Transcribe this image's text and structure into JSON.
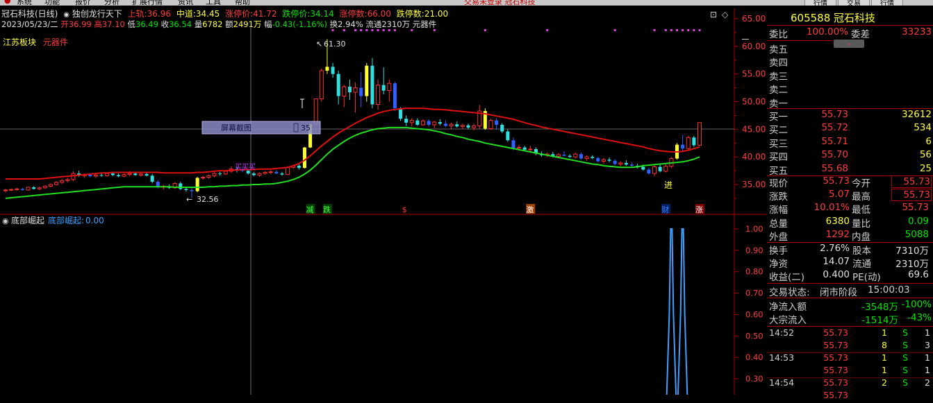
{
  "menu": {
    "items": [
      "系统",
      "功能",
      "报价",
      "分析",
      "扩展行情",
      "资讯",
      "工具",
      "帮助"
    ],
    "center_title": "交易未登录 冠石科技",
    "right_buttons": [
      "行情",
      "交易",
      "行情"
    ]
  },
  "header": {
    "stock": "冠石科技(日线)",
    "formula": "独创龙行天下",
    "up_label": "上轨:",
    "up": "36.96",
    "mid_label": "中道:",
    "mid": "34.45",
    "limit_up_label": "涨停价:",
    "limit_up": "41.72",
    "limit_down_label": "跌停价:",
    "limit_down": "34.14",
    "up_count_label": "涨停数:",
    "up_count": "66.00",
    "down_count_label": "跌停数:",
    "down_count": "21.00"
  },
  "info2": {
    "date": "2023/05/23/二",
    "open_label": "开",
    "open": "36.99",
    "high_label": "高",
    "high": "37.10",
    "low_label": "低",
    "low": "36.49",
    "close_label": "收",
    "close": "36.54",
    "vol_label": "量",
    "vol": "6782",
    "amt_label": "额",
    "amt": "2491万",
    "chg_label": "幅",
    "chg": "-0.43(-1.16%)",
    "turn": "换2.94%",
    "float": "流通2310万",
    "sector": "元器件"
  },
  "tags": {
    "board": "江苏板块",
    "sector": "元器件"
  },
  "chart_labels": {
    "high_mark": "61.30",
    "low_mark": "32.56",
    "screenshot": "屏幕截图",
    "cross_val": "35",
    "buy_text": "买买买",
    "jin": "进"
  },
  "signals": [
    "减",
    "跌",
    "$",
    "激",
    "财",
    "涨"
  ],
  "price_axis": [
    "65.00",
    "60.00",
    "55.00",
    "50.00",
    "45.00",
    "40.00",
    "35.00"
  ],
  "indicator": {
    "name": "底部崛起",
    "series_label": "底部崛起:",
    "value": "0.00",
    "axis": [
      "1.00",
      "0.90",
      "0.80",
      "0.70",
      "0.60",
      "0.50",
      "0.40",
      "0.30"
    ]
  },
  "chart_data": {
    "type": "candlestick",
    "ylim": [
      30,
      66
    ],
    "candles": [
      [
        33.9,
        34.2,
        33.6,
        34.0
      ],
      [
        34.0,
        34.3,
        33.8,
        34.1
      ],
      [
        34.1,
        34.4,
        33.9,
        34.2
      ],
      [
        34.2,
        34.4,
        33.9,
        34.0
      ],
      [
        34.0,
        34.6,
        33.9,
        34.5
      ],
      [
        34.5,
        34.7,
        34.1,
        34.2
      ],
      [
        34.2,
        34.6,
        34.0,
        34.4
      ],
      [
        34.4,
        34.9,
        34.2,
        34.7
      ],
      [
        34.7,
        35.2,
        34.5,
        35.0
      ],
      [
        35.0,
        35.6,
        34.8,
        35.4
      ],
      [
        35.4,
        36.0,
        35.1,
        35.7
      ],
      [
        35.7,
        36.2,
        35.4,
        35.9
      ],
      [
        35.9,
        37.4,
        35.6,
        37.0
      ],
      [
        37.0,
        37.5,
        36.4,
        36.6
      ],
      [
        36.6,
        37.0,
        36.2,
        36.8
      ],
      [
        36.8,
        37.0,
        36.3,
        36.5
      ],
      [
        36.5,
        36.9,
        36.2,
        36.7
      ],
      [
        36.7,
        37.1,
        36.4,
        36.6
      ],
      [
        36.6,
        37.2,
        36.4,
        37.0
      ],
      [
        37.0,
        37.2,
        36.5,
        36.7
      ],
      [
        36.7,
        37.0,
        36.3,
        36.5
      ],
      [
        36.5,
        37.0,
        36.3,
        36.8
      ],
      [
        36.8,
        37.4,
        36.5,
        37.0
      ],
      [
        37.0,
        37.3,
        36.6,
        36.7
      ],
      [
        36.7,
        37.1,
        36.4,
        36.9
      ],
      [
        36.9,
        37.2,
        36.5,
        36.6
      ],
      [
        36.6,
        36.9,
        35.2,
        35.5
      ],
      [
        35.5,
        35.8,
        34.3,
        34.5
      ],
      [
        34.5,
        34.9,
        34.1,
        34.7
      ],
      [
        34.7,
        35.0,
        34.2,
        34.4
      ],
      [
        34.4,
        35.4,
        34.2,
        35.2
      ],
      [
        35.2,
        35.5,
        34.0,
        34.2
      ],
      [
        34.2,
        34.6,
        33.7,
        34.0
      ],
      [
        34.0,
        34.4,
        32.6,
        33.8
      ],
      [
        33.8,
        36.4,
        33.6,
        36.2
      ],
      [
        36.2,
        36.6,
        35.9,
        36.3
      ],
      [
        36.3,
        36.8,
        36.0,
        36.6
      ],
      [
        36.6,
        37.2,
        36.3,
        37.0
      ],
      [
        37.0,
        37.3,
        36.6,
        36.9
      ],
      [
        36.9,
        37.6,
        36.7,
        37.4
      ],
      [
        37.4,
        38.3,
        37.1,
        37.8
      ],
      [
        37.8,
        38.2,
        37.2,
        37.6
      ],
      [
        37.6,
        38.0,
        37.2,
        37.5
      ],
      [
        37.5,
        37.8,
        36.8,
        37.0
      ],
      [
        37.0,
        37.3,
        36.5,
        36.7
      ],
      [
        36.7,
        37.2,
        36.4,
        37.0
      ],
      [
        37.0,
        37.4,
        36.8,
        37.2
      ],
      [
        37.2,
        37.6,
        36.9,
        37.3
      ],
      [
        37.3,
        37.6,
        36.9,
        37.0
      ],
      [
        37.0,
        37.3,
        36.6,
        36.8
      ],
      [
        36.8,
        38.3,
        36.7,
        38.1
      ],
      [
        38.1,
        38.6,
        37.8,
        38.4
      ],
      [
        38.4,
        38.8,
        37.7,
        38.0
      ],
      [
        38.0,
        41.8,
        37.9,
        41.7
      ],
      [
        41.7,
        46.0,
        41.6,
        45.9
      ],
      [
        45.9,
        50.5,
        45.8,
        50.5
      ],
      [
        50.5,
        56.0,
        50.0,
        55.6
      ],
      [
        55.6,
        61.3,
        55.0,
        56.3
      ],
      [
        56.3,
        57.0,
        54.3,
        55.0
      ],
      [
        55.0,
        55.6,
        49.5,
        51.0
      ],
      [
        51.0,
        53.0,
        49.0,
        52.7
      ],
      [
        52.7,
        54.0,
        50.3,
        51.7
      ],
      [
        51.7,
        53.5,
        48.0,
        52.5
      ],
      [
        52.5,
        55.3,
        49.0,
        51.0
      ],
      [
        51.0,
        57.0,
        50.0,
        56.5
      ],
      [
        56.5,
        57.9,
        48.8,
        49.5
      ],
      [
        49.5,
        54.0,
        48.5,
        53.0
      ],
      [
        53.0,
        56.2,
        51.3,
        52.0
      ],
      [
        52.0,
        54.0,
        50.0,
        53.3
      ],
      [
        53.3,
        53.6,
        48.3,
        48.8
      ],
      [
        48.8,
        49.0,
        46.5,
        46.9
      ],
      [
        46.9,
        47.5,
        45.6,
        46.2
      ],
      [
        46.2,
        47.0,
        45.5,
        46.6
      ],
      [
        46.6,
        47.0,
        45.6,
        45.8
      ],
      [
        45.8,
        46.8,
        45.6,
        46.5
      ],
      [
        46.5,
        46.8,
        45.5,
        45.8
      ],
      [
        45.8,
        46.5,
        45.2,
        46.3
      ],
      [
        46.3,
        46.8,
        45.7,
        46.0
      ],
      [
        46.0,
        46.6,
        45.4,
        45.6
      ],
      [
        45.6,
        46.2,
        45.0,
        45.9
      ],
      [
        45.9,
        46.4,
        45.3,
        45.5
      ],
      [
        45.5,
        46.0,
        45.0,
        45.7
      ],
      [
        45.7,
        46.0,
        45.0,
        45.3
      ],
      [
        45.3,
        46.0,
        44.8,
        45.6
      ],
      [
        45.6,
        49.4,
        45.0,
        48.3
      ],
      [
        48.3,
        48.8,
        44.9,
        45.1
      ],
      [
        45.1,
        46.9,
        44.9,
        46.6
      ],
      [
        46.6,
        47.0,
        44.9,
        45.8
      ],
      [
        45.8,
        46.1,
        44.3,
        44.6
      ],
      [
        44.6,
        45.0,
        42.7,
        43.0
      ],
      [
        43.0,
        43.5,
        41.2,
        41.6
      ],
      [
        41.6,
        42.2,
        41.2,
        41.7
      ],
      [
        41.7,
        42.0,
        41.1,
        41.3
      ],
      [
        41.3,
        42.0,
        41.0,
        41.4
      ],
      [
        41.4,
        41.7,
        40.3,
        40.6
      ],
      [
        40.6,
        41.0,
        40.0,
        40.3
      ],
      [
        40.3,
        40.8,
        40.0,
        40.5
      ],
      [
        40.5,
        40.9,
        39.9,
        40.1
      ],
      [
        40.1,
        40.7,
        39.8,
        40.4
      ],
      [
        40.4,
        41.0,
        40.1,
        40.2
      ],
      [
        40.2,
        40.5,
        39.8,
        40.0
      ],
      [
        40.0,
        40.8,
        39.7,
        40.5
      ],
      [
        40.5,
        40.8,
        39.5,
        39.7
      ],
      [
        39.7,
        40.3,
        39.3,
        40.0
      ],
      [
        40.0,
        40.3,
        39.6,
        39.8
      ],
      [
        39.8,
        40.0,
        39.0,
        39.2
      ],
      [
        39.2,
        39.8,
        38.8,
        39.5
      ],
      [
        39.5,
        39.9,
        39.0,
        39.3
      ],
      [
        39.3,
        39.6,
        38.5,
        38.7
      ],
      [
        38.7,
        39.2,
        38.3,
        38.9
      ],
      [
        38.9,
        39.4,
        38.4,
        38.6
      ],
      [
        38.6,
        39.0,
        38.2,
        38.4
      ],
      [
        38.4,
        38.8,
        37.9,
        38.2
      ],
      [
        38.2,
        38.6,
        37.5,
        37.7
      ],
      [
        37.7,
        38.0,
        36.8,
        37.0
      ],
      [
        37.0,
        38.5,
        36.5,
        38.2
      ],
      [
        38.2,
        38.6,
        37.2,
        37.4
      ],
      [
        37.4,
        38.8,
        37.2,
        38.3
      ],
      [
        38.3,
        40.0,
        38.0,
        39.7
      ],
      [
        39.7,
        42.5,
        39.5,
        42.2
      ],
      [
        42.2,
        44.0,
        41.0,
        41.5
      ],
      [
        41.5,
        43.8,
        41.3,
        43.5
      ],
      [
        43.5,
        43.8,
        41.8,
        42.1
      ],
      [
        42.1,
        46.2,
        42.0,
        46.2
      ]
    ],
    "ma_red": [
      36.0,
      36.0,
      36.0,
      36.0,
      36.0,
      36.0,
      36.0,
      36.1,
      36.2,
      36.3,
      36.4,
      36.5,
      36.6,
      36.7,
      36.8,
      36.9,
      37.0,
      37.1,
      37.1,
      37.2,
      37.2,
      37.2,
      37.2,
      37.2,
      37.2,
      37.2,
      37.2,
      37.2,
      37.1,
      37.1,
      37.1,
      37.1,
      37.1,
      37.1,
      37.2,
      37.2,
      37.3,
      37.4,
      37.5,
      37.5,
      37.6,
      37.6,
      37.7,
      37.7,
      37.7,
      37.8,
      37.8,
      37.8,
      37.9,
      38.0,
      38.1,
      38.4,
      38.8,
      39.4,
      40.2,
      41.1,
      42.0,
      42.8,
      43.6,
      44.3,
      44.9,
      45.5,
      46.1,
      46.6,
      47.1,
      47.5,
      47.9,
      48.2,
      48.4,
      48.6,
      48.7,
      48.8,
      48.8,
      48.8,
      48.8,
      48.7,
      48.6,
      48.6,
      48.5,
      48.4,
      48.3,
      48.2,
      48.1,
      48.0,
      47.9,
      47.8,
      47.6,
      47.4,
      47.2,
      47.0,
      46.8,
      46.5,
      46.2,
      45.9,
      45.7,
      45.4,
      45.2,
      45.0,
      44.8,
      44.6,
      44.4,
      44.2,
      44.0,
      43.8,
      43.6,
      43.4,
      43.2,
      43.0,
      42.8,
      42.6,
      42.4,
      42.2,
      42.0,
      41.8,
      41.5,
      41.3,
      41.1,
      41.0,
      40.9,
      40.9,
      41.0,
      41.2,
      41.5,
      41.8
    ],
    "ma_green": [
      32.5,
      32.6,
      32.7,
      32.8,
      32.9,
      33.0,
      33.1,
      33.2,
      33.3,
      33.4,
      33.5,
      33.6,
      33.7,
      33.8,
      33.9,
      34.0,
      34.1,
      34.2,
      34.3,
      34.4,
      34.5,
      34.6,
      34.6,
      34.6,
      34.6,
      34.6,
      34.6,
      34.6,
      34.6,
      34.6,
      34.5,
      34.5,
      34.5,
      34.5,
      34.5,
      34.5,
      34.6,
      34.6,
      34.7,
      34.7,
      34.8,
      34.8,
      34.9,
      34.9,
      35.0,
      35.0,
      35.1,
      35.1,
      35.2,
      35.4,
      35.6,
      35.9,
      36.3,
      36.9,
      37.6,
      38.5,
      39.5,
      40.5,
      41.4,
      42.1,
      42.8,
      43.4,
      43.9,
      44.3,
      44.6,
      44.9,
      45.1,
      45.2,
      45.3,
      45.3,
      45.3,
      45.3,
      45.2,
      45.1,
      45.0,
      44.9,
      44.7,
      44.5,
      44.2,
      44.0,
      43.7,
      43.5,
      43.2,
      43.0,
      42.8,
      42.5,
      42.3,
      42.1,
      41.9,
      41.7,
      41.5,
      41.3,
      41.1,
      40.9,
      40.7,
      40.5,
      40.3,
      40.1,
      39.9,
      39.7,
      39.5,
      39.3,
      39.1,
      38.9,
      38.7,
      38.6,
      38.4,
      38.3,
      38.2,
      38.1,
      38.1,
      38.1,
      38.2,
      38.4,
      38.5,
      38.6,
      38.7,
      38.8,
      38.9,
      39.0,
      39.1,
      39.3,
      39.6,
      40.0
    ],
    "indicator_spikes": [
      {
        "index": 118,
        "value": 1.0
      },
      {
        "index": 120,
        "value": 1.0
      }
    ]
  },
  "right_panel": {
    "code": "605588",
    "name": "冠石科技",
    "weibi_label": "委比",
    "weibi": "100.00%",
    "weicha_label": "委差",
    "weicha": "33233",
    "sells": [
      {
        "label": "卖五"
      },
      {
        "label": "卖四"
      },
      {
        "label": "卖三"
      },
      {
        "label": "卖二"
      },
      {
        "label": "卖一"
      }
    ],
    "buys": [
      {
        "label": "买一",
        "price": "55.73",
        "vol": "32612"
      },
      {
        "label": "买二",
        "price": "55.72",
        "vol": "534"
      },
      {
        "label": "买三",
        "price": "55.71",
        "vol": "6"
      },
      {
        "label": "买四",
        "price": "55.70",
        "vol": "56"
      },
      {
        "label": "买五",
        "price": "55.68",
        "vol": "25"
      }
    ],
    "quote": [
      {
        "l1": "现价",
        "v1": "55.73",
        "l2": "今开",
        "v2": "55.73"
      },
      {
        "l1": "涨跌",
        "v1": "5.07",
        "l2": "最高",
        "v2": "55.73"
      },
      {
        "l1": "涨幅",
        "v1": "10.01%",
        "l2": "最低",
        "v2": "55.73"
      },
      {
        "l1": "总量",
        "v1": "6380",
        "l2": "量比",
        "v2": "0.09"
      },
      {
        "l1": "外盘",
        "v1": "1292",
        "l2": "内盘",
        "v2": "5088"
      }
    ],
    "stats": [
      {
        "l1": "换手",
        "v1": "2.76%",
        "l2": "股本",
        "v2": "7310万"
      },
      {
        "l1": "净资",
        "v1": "14.07",
        "l2": "流通",
        "v2": "2310万"
      },
      {
        "l1": "收益(二)",
        "v1": "0.400",
        "l2": "PE(动)",
        "v2": "69.6"
      }
    ],
    "status_label": "交易状态:",
    "status": "闭市阶段",
    "status_time": "15:00:03",
    "netflow_label": "净流入额",
    "netflow": "-3548万",
    "netflow_pct": "-100%",
    "block_label": "大宗流入",
    "block": "-1514万",
    "block_pct": "-43%",
    "ticks": [
      {
        "time": "14:52",
        "price": "55.73",
        "vol": "1",
        "side": "S",
        "n": "1"
      },
      {
        "time": "",
        "price": "55.73",
        "vol": "8",
        "side": "S",
        "n": "3"
      },
      {
        "time": "14:53",
        "price": "55.73",
        "vol": "1",
        "side": "S",
        "n": "1"
      },
      {
        "time": "",
        "price": "55.73",
        "vol": "1",
        "side": "S",
        "n": "1"
      },
      {
        "time": "14:54",
        "price": "55.73",
        "vol": "2",
        "side": "S",
        "n": "2"
      },
      {
        "time": "",
        "price": "55.73",
        "vol": "",
        "side": "",
        "n": ""
      }
    ]
  }
}
